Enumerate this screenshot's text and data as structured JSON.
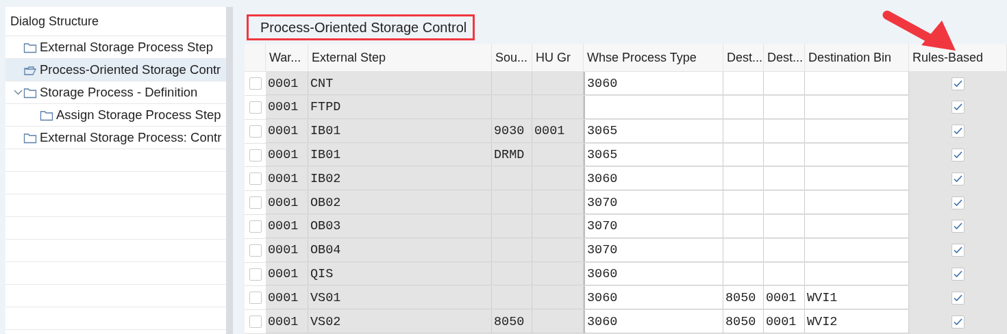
{
  "sidebar": {
    "title": "Dialog Structure",
    "items": [
      {
        "label": "External Storage Process Step",
        "selected": false,
        "expanded": false
      },
      {
        "label": "Process-Oriented Storage Contr",
        "selected": true,
        "expanded": false
      },
      {
        "label": "Storage Process - Definition",
        "selected": false,
        "expanded": true,
        "children": [
          {
            "label": "Assign Storage Process Step",
            "selected": false,
            "expanded": false
          }
        ]
      },
      {
        "label": "External Storage Process: Contr",
        "selected": false,
        "expanded": false
      }
    ]
  },
  "view": {
    "title": "Process-Oriented Storage Control",
    "highlighted": true
  },
  "table": {
    "columns": [
      {
        "label": "War...",
        "editable": false,
        "marked": false
      },
      {
        "label": "External Step",
        "editable": false,
        "marked": false
      },
      {
        "label": "Sou...",
        "editable": false,
        "marked": false
      },
      {
        "label": "HU Gr",
        "editable": false,
        "marked": false
      },
      {
        "label": "Whse Process Type",
        "editable": true,
        "marked": false
      },
      {
        "label": "Dest...",
        "editable": true,
        "marked": false
      },
      {
        "label": "Dest...",
        "editable": true,
        "marked": false
      },
      {
        "label": "Destination Bin",
        "editable": true,
        "marked": false
      },
      {
        "label": "Rules-Based",
        "editable": false,
        "marked": true
      }
    ],
    "rows": [
      {
        "selected": false,
        "warehouse": "0001",
        "step": "CNT",
        "process_type": "3060",
        "rules_based": true
      },
      {
        "selected": false,
        "warehouse": "0001",
        "step": "FTPD",
        "rules_based": true
      },
      {
        "selected": false,
        "warehouse": "0001",
        "step": "IB01",
        "source": "9030",
        "hu_group": "0001",
        "process_type": "3065",
        "rules_based": true
      },
      {
        "selected": false,
        "warehouse": "0001",
        "step": "IB01",
        "source": "DRMD",
        "process_type": "3065",
        "rules_based": true
      },
      {
        "selected": false,
        "warehouse": "0001",
        "step": "IB02",
        "process_type": "3060",
        "rules_based": true
      },
      {
        "selected": false,
        "warehouse": "0001",
        "step": "OB02",
        "process_type": "3070",
        "rules_based": true
      },
      {
        "selected": false,
        "warehouse": "0001",
        "step": "OB03",
        "process_type": "3070",
        "rules_based": true
      },
      {
        "selected": false,
        "warehouse": "0001",
        "step": "OB04",
        "process_type": "3070",
        "rules_based": true
      },
      {
        "selected": false,
        "warehouse": "0001",
        "step": "QIS",
        "process_type": "3060",
        "rules_based": true
      },
      {
        "selected": false,
        "warehouse": "0001",
        "step": "VS01",
        "process_type": "3060",
        "dest_1": "8050",
        "dest_2": "0001",
        "dest_bin": "WVI1",
        "rules_based": true
      },
      {
        "selected": false,
        "warehouse": "0001",
        "step": "VS02",
        "source": "8050",
        "process_type": "3060",
        "dest_1": "8050",
        "dest_2": "0001",
        "dest_bin": "WVI2",
        "rules_based": true
      }
    ]
  }
}
